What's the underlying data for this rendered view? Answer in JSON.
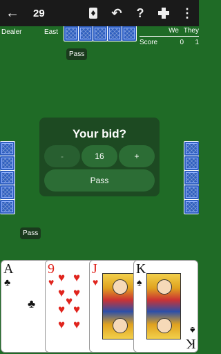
{
  "appbar": {
    "title": "29",
    "back_icon": "arrow-left-icon",
    "actions": [
      {
        "name": "card-icon",
        "glyph": "🂠"
      },
      {
        "name": "undo-icon",
        "glyph": "↶"
      },
      {
        "name": "help-icon",
        "glyph": "?"
      },
      {
        "name": "gamepad-icon",
        "glyph": "✚"
      },
      {
        "name": "more-vert-icon",
        "glyph": "⋮"
      }
    ]
  },
  "table": {
    "dealer_label": "Dealer",
    "dealer_position": "East"
  },
  "score": {
    "col_we": "We",
    "col_they": "They",
    "row_label": "Score",
    "we": "0",
    "they": "1"
  },
  "bubbles": {
    "north": "Pass",
    "west": "Pass"
  },
  "bid": {
    "prompt": "Your bid?",
    "minus": "-",
    "value": "16",
    "plus": "+",
    "pass": "Pass"
  },
  "hand": [
    {
      "rank": "A",
      "suit": "♣",
      "color": "black"
    },
    {
      "rank": "9",
      "suit": "♥",
      "color": "red"
    },
    {
      "rank": "J",
      "suit": "♥",
      "color": "red"
    },
    {
      "rank": "K",
      "suit": "♠",
      "color": "black"
    }
  ]
}
